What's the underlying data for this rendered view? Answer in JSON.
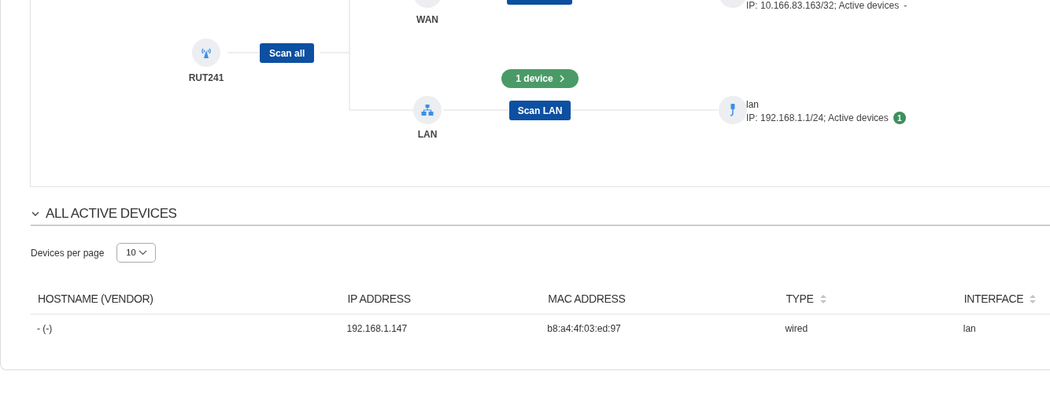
{
  "diagram": {
    "root": {
      "label": "RUT241"
    },
    "scan_all_button": "Scan all",
    "wan": {
      "label": "WAN",
      "interface": {
        "ip_line": "IP: 10.166.83.163/32; Active devices",
        "active_count": "-",
        "badge": false
      }
    },
    "lan": {
      "label": "LAN",
      "devices_pill": "1 device",
      "scan_button": "Scan LAN",
      "interface": {
        "name": "lan",
        "ip_line": "IP: 192.168.1.1/24; Active devices",
        "active_count": "1",
        "badge": true
      }
    }
  },
  "section": {
    "title": "ALL ACTIVE DEVICES",
    "expanded": true
  },
  "per_page": {
    "label": "Devices per page",
    "value": "10"
  },
  "table": {
    "columns": [
      {
        "label": "HOSTNAME (VENDOR)",
        "kind": "plain"
      },
      {
        "label": "IP ADDRESS",
        "kind": "plain"
      },
      {
        "label": "MAC ADDRESS",
        "kind": "plain"
      },
      {
        "label": "TYPE",
        "kind": "sortable"
      },
      {
        "label": "INTERFACE",
        "kind": "sortable"
      }
    ],
    "rows": [
      [
        "- (-)",
        "192.168.1.147",
        "b8:a4:4f:03:ed:97",
        "wired",
        "lan"
      ]
    ]
  }
}
